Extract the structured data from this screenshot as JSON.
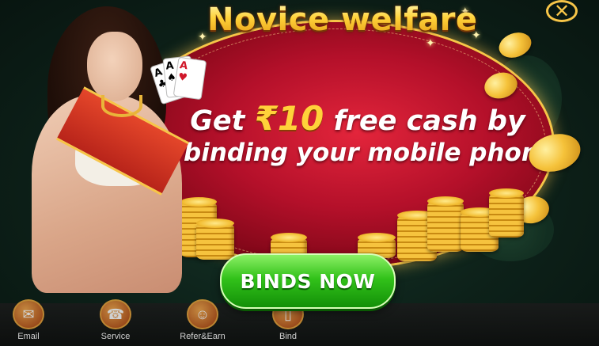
{
  "popup": {
    "title": "Novice welfare",
    "headline_prefix": "Get",
    "headline_amount": "₹10",
    "headline_suffix": "free cash by",
    "headline_line2": "binding your mobile phone",
    "cta_label": "BINDS NOW",
    "close_glyph": "✕"
  },
  "cards": [
    {
      "rank": "A",
      "suit": "♣",
      "color": "#111111"
    },
    {
      "rank": "A",
      "suit": "♠",
      "color": "#111111"
    },
    {
      "rank": "A",
      "suit": "♥",
      "color": "#d0182a"
    }
  ],
  "bottom_nav": {
    "items": [
      {
        "label": "Email",
        "icon": "envelope-icon",
        "glyph": "✉"
      },
      {
        "label": "Service",
        "icon": "headset-icon",
        "glyph": "☎"
      },
      {
        "label": "Refer&Earn",
        "icon": "people-icon",
        "glyph": "☺"
      },
      {
        "label": "Bind",
        "icon": "phone-icon",
        "glyph": "▯"
      }
    ]
  },
  "colors": {
    "accent_gold": "#f7c548",
    "popup_red": "#b4102a",
    "cta_green": "#32c21a"
  }
}
